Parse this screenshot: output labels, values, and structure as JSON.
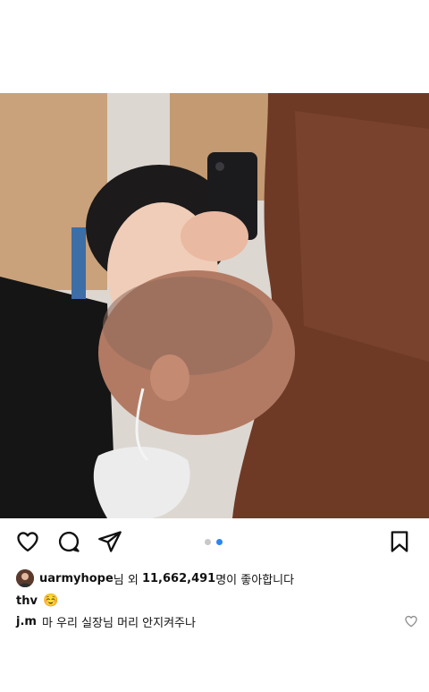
{
  "post": {
    "image_alt": "Photo of a person taking a mirror-selfie backstage with a makeup artist"
  },
  "actions": {
    "like_icon": "heart-icon",
    "comment_icon": "comment-icon",
    "share_icon": "send-icon",
    "save_icon": "bookmark-icon"
  },
  "carousel": {
    "total": 2,
    "active_index": 2
  },
  "likes": {
    "username": "uarmyhope",
    "suffix_before_count": "님 외 ",
    "count": "11,662,491",
    "suffix_after_count": "명이 좋아합니다"
  },
  "caption": {
    "username": "thv",
    "text": "☺️"
  },
  "comment": {
    "username": "j.m",
    "text": "마 우리 실장님 머리 안지켜주나"
  },
  "colors": {
    "accent": "#2a86f3",
    "inactive_dot": "#c8c8c8"
  }
}
